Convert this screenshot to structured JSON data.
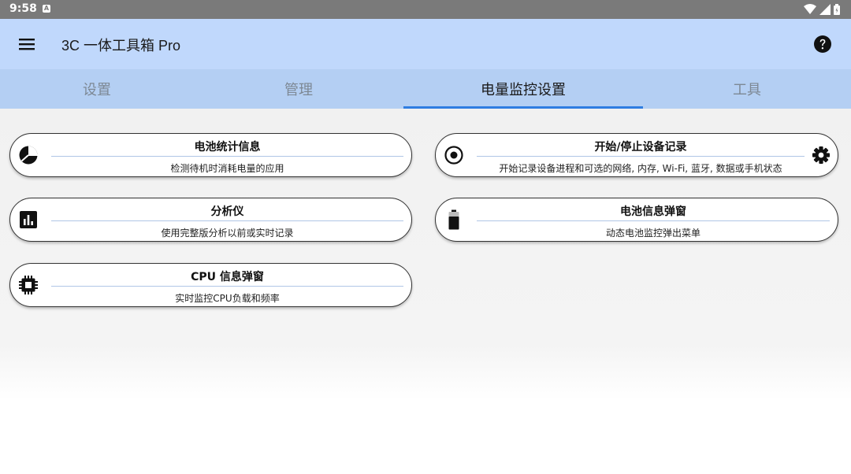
{
  "status": {
    "time": "9:58",
    "notif_letter": "A"
  },
  "app_bar": {
    "title": "3C 一体工具箱 Pro"
  },
  "tabs": [
    {
      "label": "设置",
      "active": false
    },
    {
      "label": "管理",
      "active": false
    },
    {
      "label": "电量监控设置",
      "active": true
    },
    {
      "label": "工具",
      "active": false
    }
  ],
  "cards": [
    {
      "title": "电池统计信息",
      "subtitle": "检测待机时消耗电量的应用",
      "icon": "pie-chart-icon"
    },
    {
      "title": "分析仪",
      "subtitle": "使用完整版分析以前或实时记录",
      "icon": "bar-chart-icon"
    },
    {
      "title": "CPU 信息弹窗",
      "subtitle": "实时监控CPU负载和频率",
      "icon": "cpu-chip-icon"
    },
    {
      "title": "开始/停止设备记录",
      "subtitle": "开始记录设备进程和可选的网络, 内存, Wi-Fi, 蓝牙, 数据或手机状态",
      "icon": "record-icon"
    },
    {
      "title": "电池信息弹窗",
      "subtitle": "动态电池监控弹出菜单",
      "icon": "battery-icon"
    }
  ],
  "colors": {
    "app_bar": "#c0d8fc",
    "tabs_bg": "#b4cff3",
    "tab_indicator": "#2f7de1",
    "status_bar": "#7a7a7a"
  }
}
